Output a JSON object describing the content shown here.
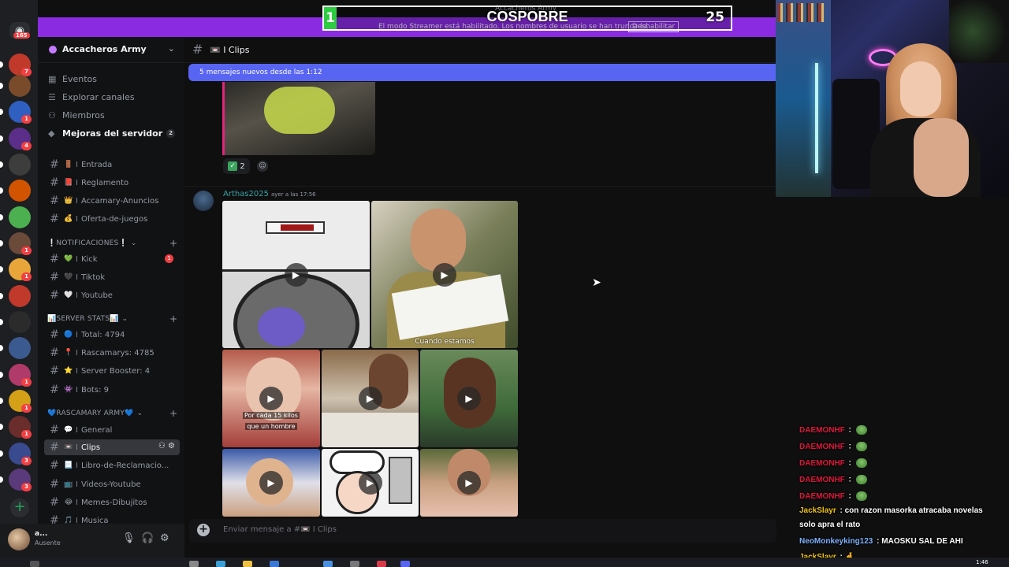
{
  "overlay": {
    "score_left": "1",
    "title": "COSPOBRE",
    "score_right": "25"
  },
  "topbar": {
    "server_name": "Accacheros Army",
    "streamer_notice": "El modo Streamer está habilitado. Los nombres de usuario se han truncado.",
    "disable_label": "Deshabilitar"
  },
  "rail": {
    "dm_badge": "165",
    "servers": [
      {
        "color": "#c0392b",
        "badge": "7"
      },
      {
        "color": "#7a4b2a",
        "badge": ""
      },
      {
        "color": "#2e5fc1",
        "badge": "1"
      },
      {
        "color": "#5b2e8a",
        "badge": "4"
      },
      {
        "color": "#3d3d3d",
        "badge": ""
      },
      {
        "color": "#d35400",
        "badge": ""
      },
      {
        "color": "#4caf50",
        "badge": ""
      },
      {
        "color": "#6b4a3a",
        "badge": "1"
      },
      {
        "color": "#e8a53a",
        "badge": "1"
      },
      {
        "color": "#c0392b",
        "badge": ""
      },
      {
        "color": "#2b2b2b",
        "badge": ""
      },
      {
        "color": "#3b5a8f",
        "badge": ""
      },
      {
        "color": "#b03a6a",
        "badge": "1"
      },
      {
        "color": "#d4a017",
        "badge": "1"
      },
      {
        "color": "#6b2c2c",
        "badge": "1"
      },
      {
        "color": "#394a8f",
        "badge": "3"
      },
      {
        "color": "#5a3a7a",
        "badge": "3"
      }
    ]
  },
  "sidebar": {
    "server_name": "Accacheros Army",
    "nav": [
      {
        "label": "Eventos",
        "icon": "calendar-icon"
      },
      {
        "label": "Explorar canales",
        "icon": "compass-icon"
      },
      {
        "label": "Miembros",
        "icon": "members-icon"
      },
      {
        "label": "Mejoras del servidor",
        "icon": "boost-icon",
        "badge": "2"
      }
    ],
    "channels_top": [
      {
        "emoji": "🚪",
        "label": "Entrada"
      },
      {
        "emoji": "📕",
        "label": "Reglamento"
      },
      {
        "emoji": "👑",
        "label": "Accamary-Anuncios"
      },
      {
        "emoji": "💰",
        "label": "Oferta-de-juegos"
      }
    ],
    "cat_notifs": "❕NOTIFICACIONES❕",
    "channels_notifs": [
      {
        "emoji": "💚",
        "label": "Kick",
        "badge": "1"
      },
      {
        "emoji": "🖤",
        "label": "Tiktok"
      },
      {
        "emoji": "🤍",
        "label": "Youtube"
      }
    ],
    "cat_stats": "📊SERVER STATS📊",
    "channels_stats": [
      {
        "emoji": "🔵",
        "label": "Total: 4794"
      },
      {
        "emoji": "📍",
        "label": "Rascamarys: 4785"
      },
      {
        "emoji": "⭐",
        "label": "Server Booster: 4"
      },
      {
        "emoji": "👾",
        "label": "Bots: 9"
      }
    ],
    "cat_army": "💙RASCAMARY ARMY💙",
    "channels_army": [
      {
        "emoji": "💬",
        "label": "General"
      },
      {
        "emoji": "📼",
        "label": "Clips"
      },
      {
        "emoji": "📃",
        "label": "Libro-de-Reclamacio..."
      },
      {
        "emoji": "📺",
        "label": "Videos-Youtube"
      },
      {
        "emoji": "😂",
        "label": "Memes-Dibujitos"
      },
      {
        "emoji": "🎵",
        "label": "Musica"
      }
    ],
    "bar": "I"
  },
  "user": {
    "name": "a...",
    "status": "Ausente"
  },
  "chat": {
    "channel_title": "📼 I Clips",
    "new_messages": "5 mensajes nuevos desde las 1:12",
    "reaction_count": "2",
    "author": "Arthas2025",
    "timestamp": "ayer a las 17:56",
    "captions": {
      "video2": "Cuando estamos",
      "video3_a": "Por cada 15 kilos",
      "video3_b": "que un hombre"
    },
    "composer_placeholder": "Enviar mensaje a #📼 I Clips"
  },
  "stream_chat": [
    {
      "user": "DAEMONHF",
      "color": "#e0183c",
      "text": "",
      "emote": true
    },
    {
      "user": "DAEMONHF",
      "color": "#e0183c",
      "text": "",
      "emote": true
    },
    {
      "user": "DAEMONHF",
      "color": "#e0183c",
      "text": "",
      "emote": true
    },
    {
      "user": "DAEMONHF",
      "color": "#e0183c",
      "text": "",
      "emote": true
    },
    {
      "user": "DAEMONHF",
      "color": "#e0183c",
      "text": "",
      "emote": true
    },
    {
      "user": "JackSlayr",
      "color": "#f1c40f",
      "text": "con razon masorka atracaba novelas",
      "emote": false
    },
    {
      "user": "",
      "color": "#ffffff",
      "text": "solo apra el rato",
      "emote": false
    },
    {
      "user": "NeoMonkeyking123",
      "color": "#7fb2ff",
      "text": "MAOSKU SAL DE AHI",
      "emote": false
    },
    {
      "user": "JackSlayr",
      "color": "#f1c40f",
      "text": "🤞",
      "emote": false
    }
  ],
  "taskbar": {
    "time": "1:46"
  }
}
